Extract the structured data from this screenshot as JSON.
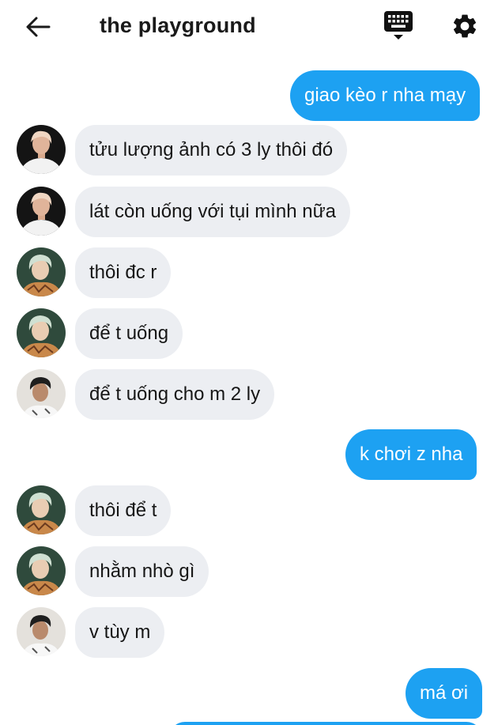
{
  "header": {
    "title": "the playground",
    "back_icon": "arrow-left-icon",
    "keyboard_icon": "keyboard-icon",
    "settings_icon": "gear-icon"
  },
  "colors": {
    "accent": "#1da1f2",
    "incoming_bubble": "#eceef2",
    "text": "#161616"
  },
  "messages": [
    {
      "from": "me",
      "text": "giao kèo r nha mạy"
    },
    {
      "from": "user-a",
      "text": "tửu lượng ảnh có 3 ly thôi đó"
    },
    {
      "from": "user-a",
      "text": "lát còn uống với tụi mình nữa"
    },
    {
      "from": "user-b",
      "text": "thôi đc r"
    },
    {
      "from": "user-b",
      "text": "để t uống"
    },
    {
      "from": "user-c",
      "text": "để t uống cho m 2 ly"
    },
    {
      "from": "me",
      "text": "k chơi z nha"
    },
    {
      "from": "user-b",
      "text": "thôi để t"
    },
    {
      "from": "user-b",
      "text": "nhằm nhò gì"
    },
    {
      "from": "user-c",
      "text": "v tùy m"
    },
    {
      "from": "me",
      "text": "má ơi"
    }
  ]
}
